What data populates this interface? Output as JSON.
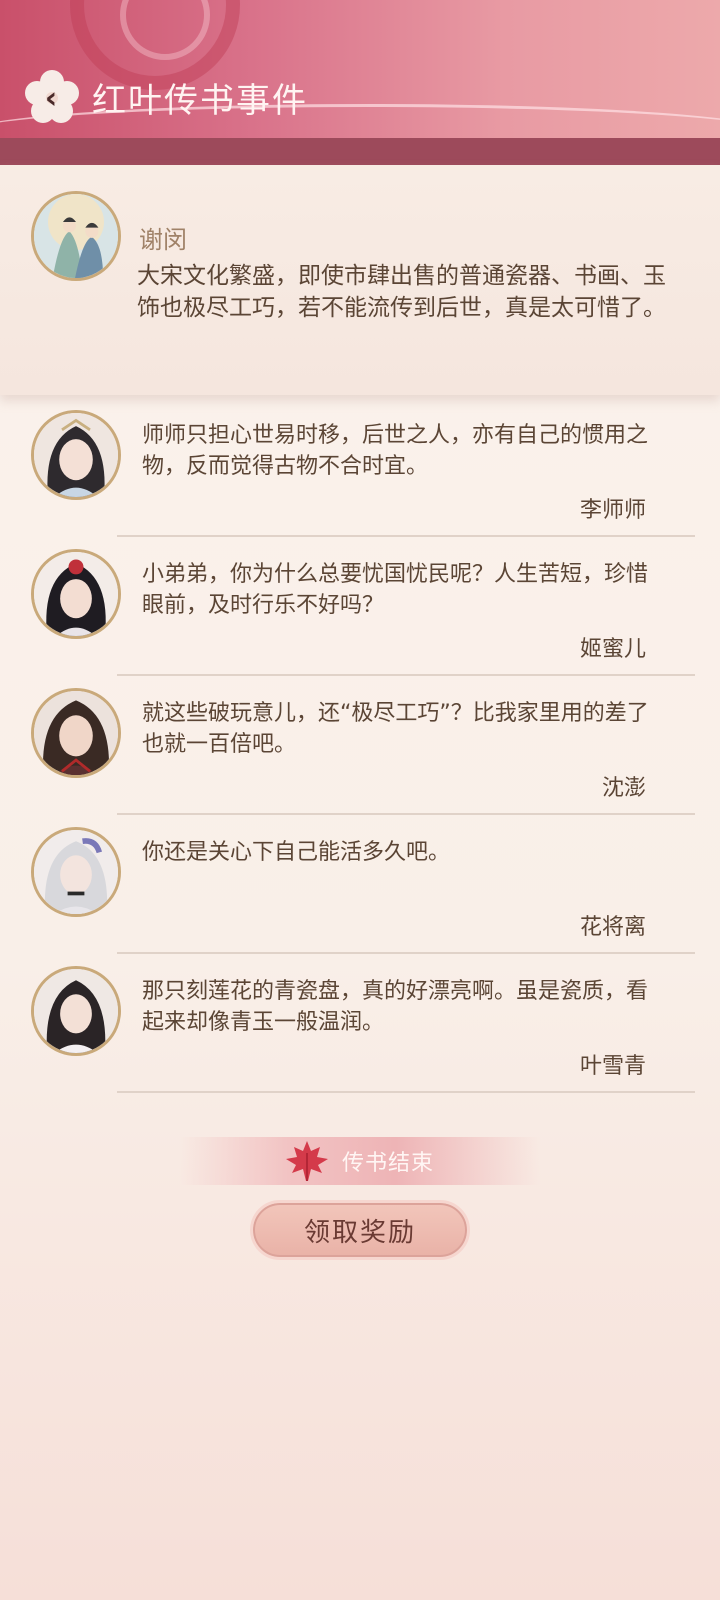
{
  "header": {
    "title": "红叶传书事件",
    "back_icon": "chevron-left-icon",
    "colors": {
      "primary": "#c9506a",
      "band": "#9d4a5b"
    }
  },
  "post": {
    "author": "谢闵",
    "text": "大宋文化繁盛，即使市肆出售的普通瓷器、书画、玉饰也极尽工巧，若不能流传到后世，真是太可惜了。"
  },
  "comments": [
    {
      "text": "师师只担心世易时移，后世之人，亦有自己的惯用之物，反而觉得古物不合时宜。",
      "author": "李师师"
    },
    {
      "text": "小弟弟，你为什么总要忧国忧民呢？人生苦短，珍惜眼前，及时行乐不好吗？",
      "author": "姬蜜儿"
    },
    {
      "text": "就这些破玩意儿，还“极尽工巧”？比我家里用的差了也就一百倍吧。",
      "author": "沈澎"
    },
    {
      "text": "你还是关心下自己能活多久吧。",
      "author": "花将离"
    },
    {
      "text": "那只刻莲花的青瓷盘，真的好漂亮啊。虽是瓷质，看起来却像青玉一般温润。",
      "author": "叶雪青"
    }
  ],
  "footer": {
    "end_label": "传书结束",
    "reward_button": "领取奖励"
  }
}
